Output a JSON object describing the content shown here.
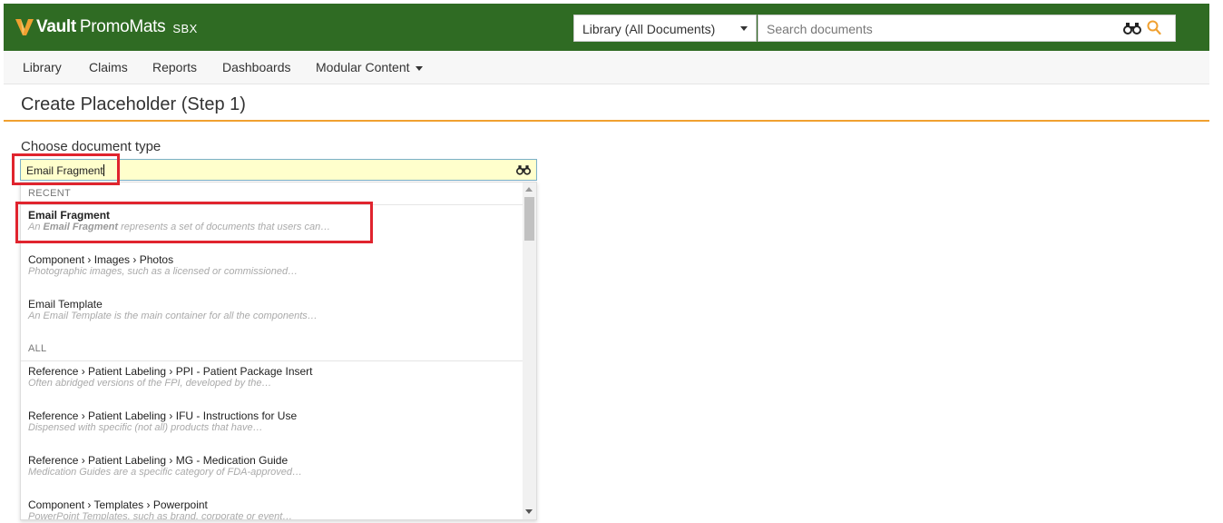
{
  "header": {
    "brand_vault": "Vault",
    "brand_app": "PromoMats",
    "environment": "SBX",
    "scope_selected": "Library (All Documents)",
    "search_placeholder": "Search documents",
    "colors": {
      "header_bg": "#2f6b23",
      "logo_accent": "#f0a030",
      "title_rule": "#f0a030"
    }
  },
  "nav": {
    "items": [
      {
        "label": "Library"
      },
      {
        "label": "Claims"
      },
      {
        "label": "Reports"
      },
      {
        "label": "Dashboards"
      },
      {
        "label": "Modular Content"
      }
    ]
  },
  "page": {
    "title": "Create Placeholder (Step 1)",
    "field_label": "Choose document type",
    "field_value": "Email Fragment"
  },
  "dropdown": {
    "recent_header": "RECENT",
    "all_header": "ALL",
    "recent": [
      {
        "name": "Email Fragment",
        "desc_prefix": "An ",
        "desc_bold": "Email Fragment",
        "desc_rest": " represents a set of documents that users can…"
      },
      {
        "name": "Component › Images › Photos",
        "desc": "Photographic images, such as a licensed or commissioned…"
      },
      {
        "name": "Email Template",
        "desc": "An Email Template is the main container for all the components…"
      }
    ],
    "all": [
      {
        "name": "Reference › Patient Labeling › PPI - Patient Package Insert",
        "desc": "Often abridged versions of the FPI, developed by the…"
      },
      {
        "name": "Reference › Patient Labeling › IFU - Instructions for Use",
        "desc": "Dispensed with specific (not all) products that have…"
      },
      {
        "name": "Reference › Patient Labeling › MG - Medication Guide",
        "desc": "Medication Guides are a specific category of FDA-approved…"
      },
      {
        "name": "Component › Templates › Powerpoint",
        "desc": "PowerPoint Templates, such as brand, corporate or event…"
      }
    ]
  },
  "icons": {
    "logo": "vault-v-logo-icon",
    "scope_caret": "caret-down-icon",
    "search_binoculars": "binoculars-icon",
    "search_magnifier": "search-icon",
    "field_binoculars": "binoculars-icon"
  }
}
